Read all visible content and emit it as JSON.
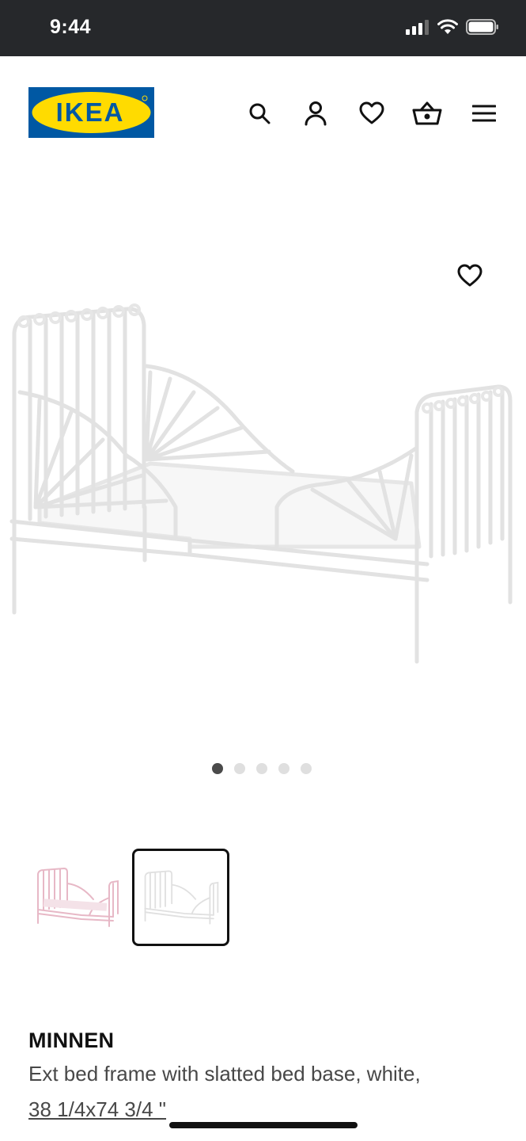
{
  "status_bar": {
    "time": "9:44",
    "icons": [
      "signal-icon",
      "wifi-icon",
      "battery-icon"
    ]
  },
  "header": {
    "logo_text": "IKEA",
    "logo_colors": {
      "background": "#0058a3",
      "oval": "#ffdb00",
      "text": "#0058a3"
    },
    "nav_icons": [
      "search-icon",
      "account-icon",
      "wishlist-heart-icon",
      "shopping-basket-icon",
      "hamburger-menu-icon"
    ]
  },
  "gallery": {
    "image_count": 5,
    "active_index": 0,
    "favorite_icon": "heart-outline-icon"
  },
  "thumbnails": [
    {
      "variant": "pink",
      "selected": false
    },
    {
      "variant": "white",
      "selected": true
    }
  ],
  "product": {
    "name": "MINNEN",
    "description": "Ext bed frame with slatted bed base, white,",
    "size": "38 1/4x74 3/4 \""
  }
}
